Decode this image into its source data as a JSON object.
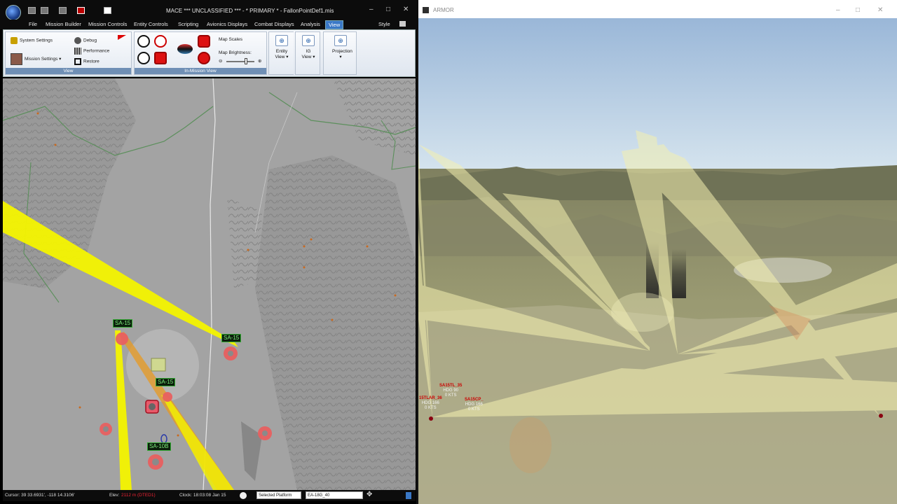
{
  "mace": {
    "title": "MACE *** UNCLASSIFIED *** - * PRIMARY * - FallonPointDef1.mis",
    "window_controls": {
      "minimize": "–",
      "maximize": "□",
      "close": "✕"
    },
    "menu": [
      "File",
      "Mission Builder",
      "Mission Controls",
      "Entity Controls",
      "Scripting",
      "Avionics Displays",
      "Combat Displays",
      "Analysis",
      "View"
    ],
    "active_menu": "View",
    "style_label": "Style",
    "ribbon": {
      "view_group": {
        "label": "View",
        "system_settings": "System Settings",
        "mission_settings": "Mission Settings",
        "debug": "Debug",
        "performance": "Performance",
        "restore": "Restore"
      },
      "in_mission_group": {
        "label": "In-Mission View",
        "map_scales": "Map Scales",
        "map_brightness": "Map Brightness:",
        "brightness_minus": "⊖",
        "brightness_plus": "⊕"
      },
      "entity_view": {
        "line1": "Entity",
        "line2": "View"
      },
      "ig_view": {
        "line1": "IG",
        "line2": "View"
      },
      "projection": {
        "line1": "Projection"
      }
    },
    "map_labels": {
      "site1": "SA-15",
      "site2": "SA-15",
      "site3": "SA-15",
      "site4": "SA-10B"
    },
    "status": {
      "cursor": "Cursor: 39 33.6931', -118 14.3106'",
      "elev_label": "Elev:",
      "elev_value": "2112 m (DTED1)",
      "clock": "Clock: 18:03:08  Jan 15",
      "selected_platform": "Selected Platform",
      "platform_value": "EA-18G_40"
    }
  },
  "armor": {
    "title": "ARMOR",
    "window_controls": {
      "minimize": "–",
      "maximize": "□",
      "close": "✕"
    },
    "targets": [
      {
        "name": "SA15TL_35",
        "hdg": "HDG 90",
        "spd": "0 KTS"
      },
      {
        "name": "15TLAR_36",
        "hdg": "HDG 166",
        "spd": "0 KTS"
      },
      {
        "name": "SA15CP_",
        "hdg": "HDG 166",
        "spd": "0 KTS"
      }
    ]
  },
  "colors": {
    "threat_ring": "#f4f400",
    "site_label_text": "#7ef07e",
    "ribbon_accent": "#3a78c6",
    "target_label_red": "#cc0000"
  },
  "icons": [
    "globe-logo-icon",
    "settings-icon",
    "debug-icon",
    "performance-icon",
    "restore-icon",
    "flag-icon",
    "arrow-down-icon"
  ]
}
